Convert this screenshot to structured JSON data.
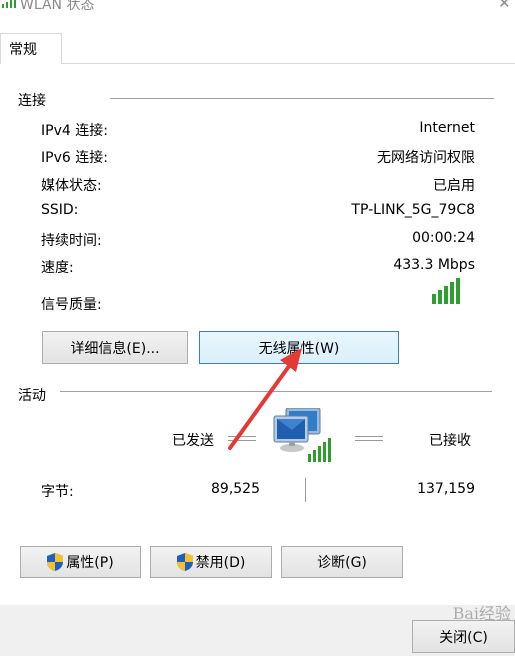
{
  "window": {
    "title": "WLAN 状态",
    "close_glyph": "✕"
  },
  "tabs": [
    {
      "label": "常规"
    }
  ],
  "connection": {
    "group_label": "连接",
    "rows": [
      {
        "label": "IPv4 连接:",
        "value": "Internet"
      },
      {
        "label": "IPv6 连接:",
        "value": "无网络访问权限"
      },
      {
        "label": "媒体状态:",
        "value": "已启用"
      },
      {
        "label": "SSID:",
        "value": "TP-LINK_5G_79C8"
      },
      {
        "label": "持续时间:",
        "value": "00:00:24"
      },
      {
        "label": "速度:",
        "value": "433.3 Mbps"
      }
    ],
    "signal_label": "信号质量:",
    "signal_bars": 5,
    "details_button": "详细信息(E)...",
    "wireless_props_button": "无线属性(W)"
  },
  "activity": {
    "group_label": "活动",
    "sent_label": "已发送",
    "received_label": "已接收",
    "bytes_label": "字节:",
    "bytes_sent": "89,525",
    "bytes_received": "137,159"
  },
  "buttons": {
    "properties": "属性(P)",
    "disable": "禁用(D)",
    "diagnose": "诊断(G)",
    "close": "关闭(C)"
  },
  "watermark": {
    "text": "Bai经验"
  },
  "colors": {
    "accent_arrow": "#e53935",
    "signal_green": "#2e9e2e",
    "focus_border": "#3c7fb1"
  }
}
